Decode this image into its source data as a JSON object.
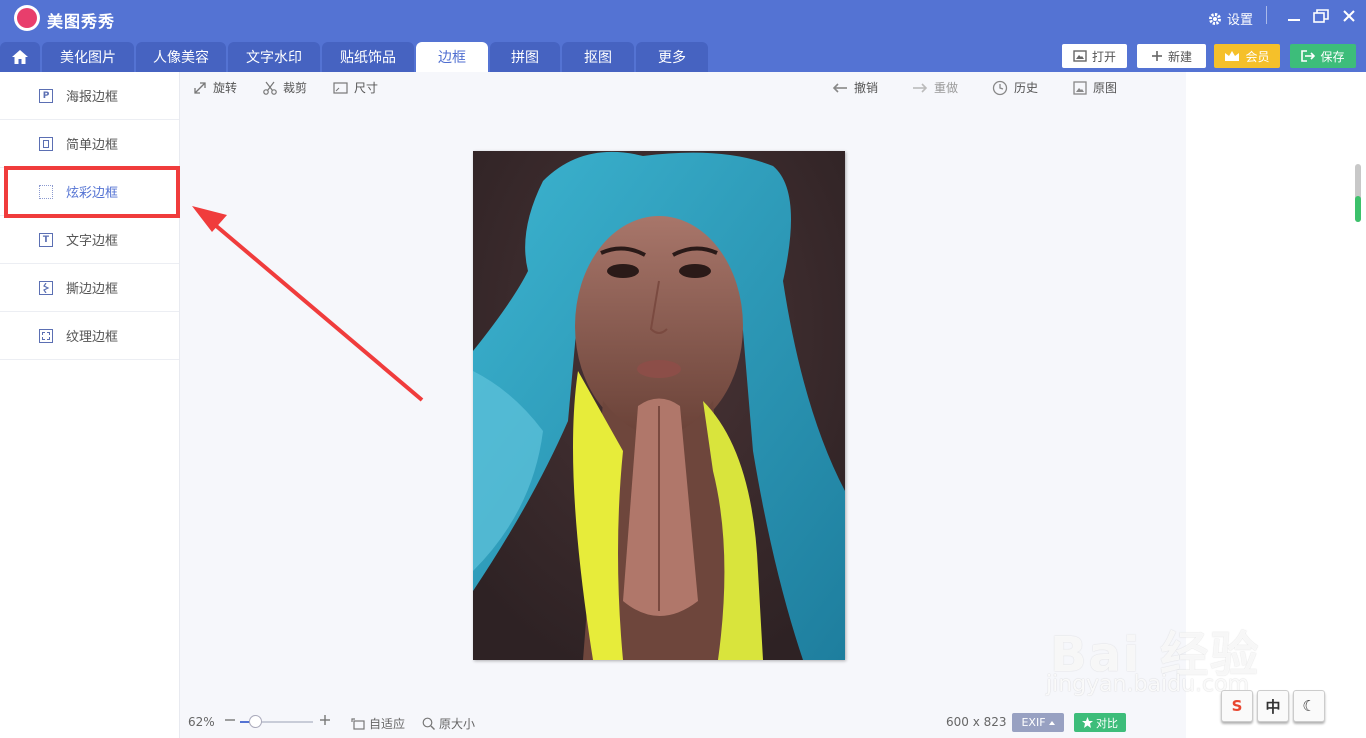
{
  "app": {
    "name": "美图秀秀",
    "settings_label": "设置"
  },
  "tabs": [
    {
      "label": "美化图片"
    },
    {
      "label": "人像美容"
    },
    {
      "label": "文字水印"
    },
    {
      "label": "贴纸饰品"
    },
    {
      "label": "边框",
      "active": true
    },
    {
      "label": "拼图"
    },
    {
      "label": "抠图"
    },
    {
      "label": "更多"
    }
  ],
  "actions": {
    "open": "打开",
    "new": "新建",
    "vip": "会员",
    "save": "保存"
  },
  "sidebar": {
    "items": [
      {
        "label": "海报边框",
        "icon": "P"
      },
      {
        "label": "简单边框",
        "icon": ""
      },
      {
        "label": "炫彩边框",
        "icon": "",
        "active": true
      },
      {
        "label": "文字边框",
        "icon": "T"
      },
      {
        "label": "撕边边框",
        "icon": ""
      },
      {
        "label": "纹理边框",
        "icon": ""
      }
    ]
  },
  "toolbar": {
    "rotate": "旋转",
    "crop": "裁剪",
    "size": "尺寸",
    "undo": "撤销",
    "redo": "重做",
    "history": "历史",
    "original": "原图"
  },
  "footer": {
    "zoom": "62%",
    "zoom_fraction": 0.2,
    "fit": "自适应",
    "actual_size": "原大小",
    "dimensions": "600 x 823",
    "exif": "EXIF",
    "compare": "对比"
  },
  "ime": {
    "s_label": "S",
    "zh_label": "中",
    "moon_label": "☾"
  },
  "watermark": {
    "main": "Bai 经验",
    "sub": "jingyan.baidu.com"
  },
  "colors": {
    "primary": "#5473d3",
    "highlight": "#f03c3c",
    "save": "#3dbd7a",
    "vip": "#f5c02a"
  }
}
